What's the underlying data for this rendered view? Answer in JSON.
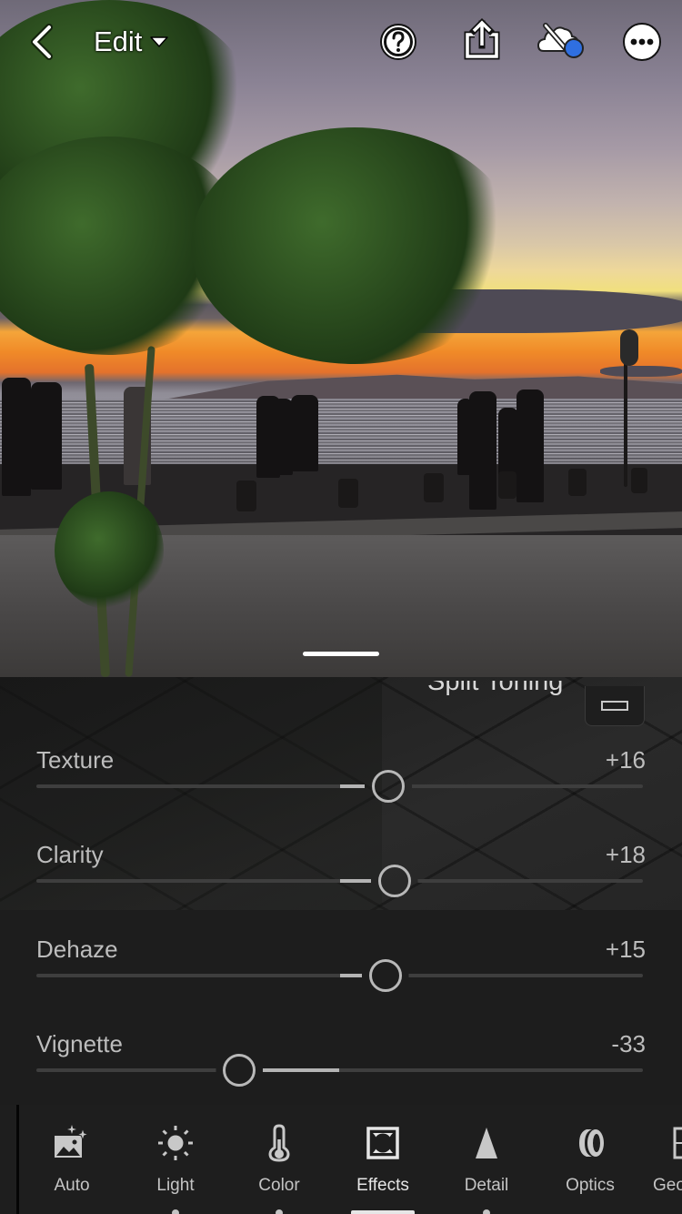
{
  "topbar": {
    "back_icon": "chevron-left-icon",
    "mode_label": "Edit",
    "mode_dropdown_icon": "caret-down-icon",
    "actions": [
      {
        "name": "help",
        "icon": "help-circle-icon"
      },
      {
        "name": "share",
        "icon": "share-icon"
      },
      {
        "name": "cloud-sync",
        "icon": "cloud-sync-off-icon",
        "badge_color": "#2f6fe0"
      },
      {
        "name": "more",
        "icon": "more-dots-icon"
      }
    ]
  },
  "photo": {
    "description": "Sunset over seaside promenade with people and tree"
  },
  "panel": {
    "section_title": "Split Toning",
    "profile_button_icon": "vignette-box-icon",
    "sliders": [
      {
        "label": "Texture",
        "value": "+16",
        "numeric": 16,
        "min": -100,
        "max": 100
      },
      {
        "label": "Clarity",
        "value": "+18",
        "numeric": 18,
        "min": -100,
        "max": 100
      },
      {
        "label": "Dehaze",
        "value": "+15",
        "numeric": 15,
        "min": -100,
        "max": 100
      },
      {
        "label": "Vignette",
        "value": "-33",
        "numeric": -33,
        "min": -100,
        "max": 100
      }
    ]
  },
  "toolbar": {
    "tools": [
      {
        "label": "Auto",
        "icon": "auto-sparkle-image-icon",
        "has_dot": false,
        "active": false
      },
      {
        "label": "Light",
        "icon": "sun-icon",
        "has_dot": true,
        "active": false
      },
      {
        "label": "Color",
        "icon": "thermometer-icon",
        "has_dot": true,
        "active": false
      },
      {
        "label": "Effects",
        "icon": "effects-square-icon",
        "has_dot": false,
        "active": true
      },
      {
        "label": "Detail",
        "icon": "triangle-icon",
        "has_dot": true,
        "active": false
      },
      {
        "label": "Optics",
        "icon": "lens-icon",
        "has_dot": false,
        "active": false
      },
      {
        "label": "Geometry",
        "icon": "geometry-icon",
        "has_dot": false,
        "active": false
      }
    ]
  },
  "colors": {
    "panel_bg": "#1d1d1d",
    "slider_text": "#bdbdbd",
    "accent_blue": "#2f6fe0"
  }
}
